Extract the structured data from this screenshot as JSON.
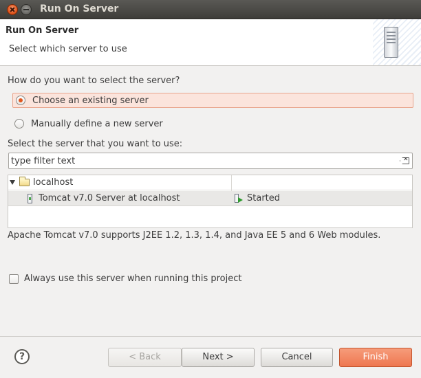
{
  "window": {
    "title": "Run On Server"
  },
  "header": {
    "title": "Run On Server",
    "subtitle": "Select which server to use"
  },
  "selection": {
    "question": "How do you want to select the server?",
    "options": [
      {
        "label": "Choose an existing server",
        "selected": true
      },
      {
        "label": "Manually define a new server",
        "selected": false
      }
    ]
  },
  "server_list": {
    "label": "Select the server that you want to use:",
    "filter_placeholder": "type filter text",
    "rows": [
      {
        "name": "localhost",
        "state": ""
      },
      {
        "name": "Tomcat v7.0 Server at localhost",
        "state": "Started"
      }
    ]
  },
  "description": "Apache Tomcat v7.0 supports J2EE 1.2, 1.3, 1.4, and Java EE 5 and 6 Web modules.",
  "always_use": {
    "label": "Always use this server when running this project",
    "checked": false
  },
  "buttons": {
    "back": "< Back",
    "next": "Next >",
    "cancel": "Cancel",
    "finish": "Finish"
  },
  "colors": {
    "accent": "#ee7750",
    "selection_bg": "#fbe4dc",
    "titlebar": "#3e3d39"
  }
}
